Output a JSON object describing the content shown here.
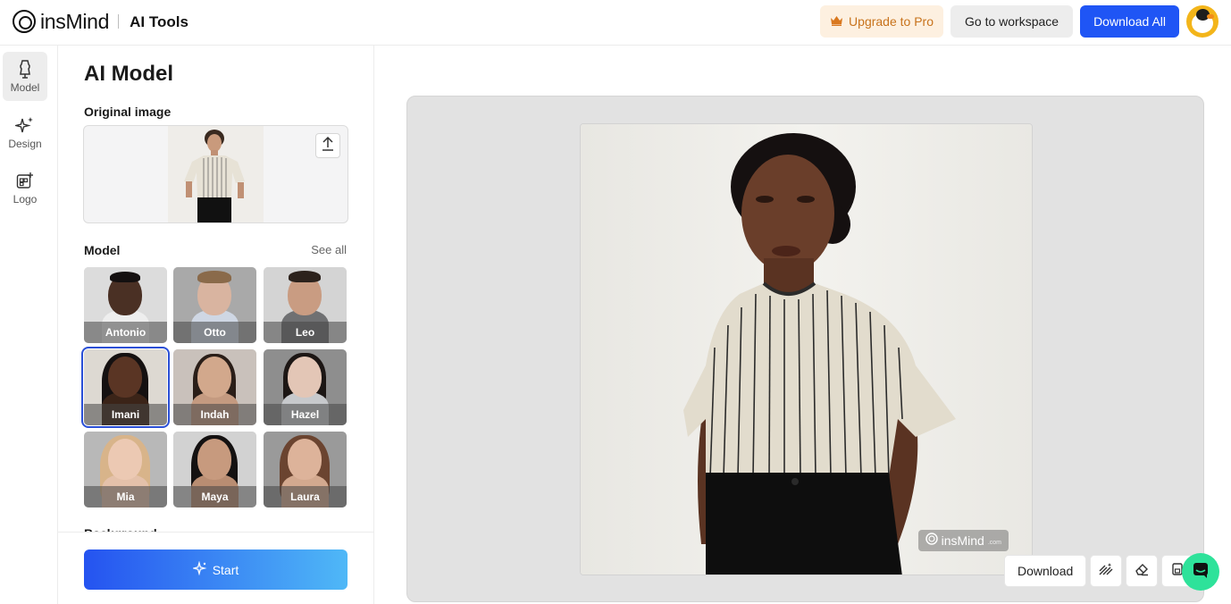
{
  "header": {
    "brand_name": "insMind",
    "section_title": "AI Tools",
    "upgrade_label": "Upgrade to Pro",
    "workspace_label": "Go to workspace",
    "download_all_label": "Download All",
    "upgrade_icon": "crown-icon",
    "avatar_icon": "duck-avatar"
  },
  "rail": {
    "items": [
      {
        "label": "Model",
        "icon": "dress-form-icon",
        "active": true
      },
      {
        "label": "Design",
        "icon": "sparkle-icon",
        "active": false
      },
      {
        "label": "Logo",
        "icon": "logo-add-icon",
        "active": false
      }
    ]
  },
  "panel": {
    "title": "AI Model",
    "original_image_label": "Original image",
    "model_label": "Model",
    "see_all_label": "See all",
    "next_section_label": "Background",
    "models": [
      {
        "name": "Antonio",
        "selected": false
      },
      {
        "name": "Otto",
        "selected": false
      },
      {
        "name": "Leo",
        "selected": false
      },
      {
        "name": "Imani",
        "selected": true
      },
      {
        "name": "Indah",
        "selected": false
      },
      {
        "name": "Hazel",
        "selected": false
      },
      {
        "name": "Mia",
        "selected": false
      },
      {
        "name": "Maya",
        "selected": false
      },
      {
        "name": "Laura",
        "selected": false
      }
    ],
    "start_label": "Start"
  },
  "canvas": {
    "watermark_text": "insMind",
    "watermark_sub": ".com",
    "download_label": "Download",
    "tool_icons": [
      "enhance-icon",
      "eraser-icon",
      "crop-icon"
    ],
    "chat_icon": "chat-icon"
  },
  "colors": {
    "accent": "#1f55f5",
    "upgrade_text": "#c8731c",
    "upgrade_bg": "#fdf0e0",
    "selected_outline": "#2a4fd6",
    "chat": "#2ee29a"
  }
}
